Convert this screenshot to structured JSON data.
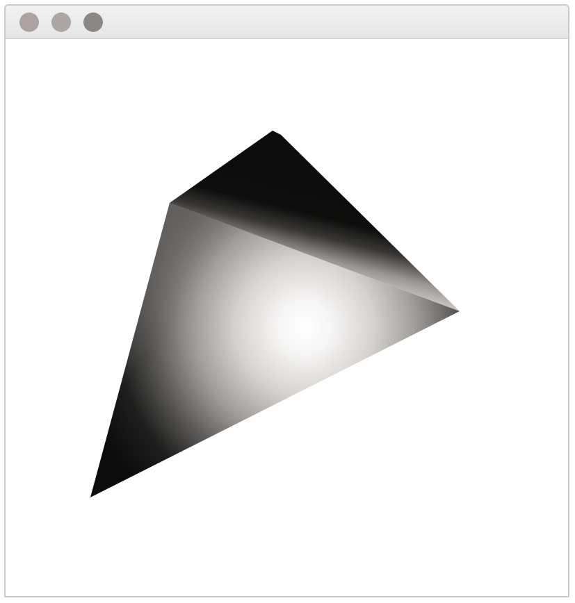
{
  "window": {
    "title": "",
    "controls": {
      "close_icon": "close-icon",
      "minimize_icon": "minimize-icon",
      "maximize_icon": "maximize-icon"
    }
  },
  "scene": {
    "object": "shaded-tetrahedron",
    "background_color": "#ffffff",
    "dark_color": "#0b0c0b",
    "highlight_color": "#ffffff"
  }
}
